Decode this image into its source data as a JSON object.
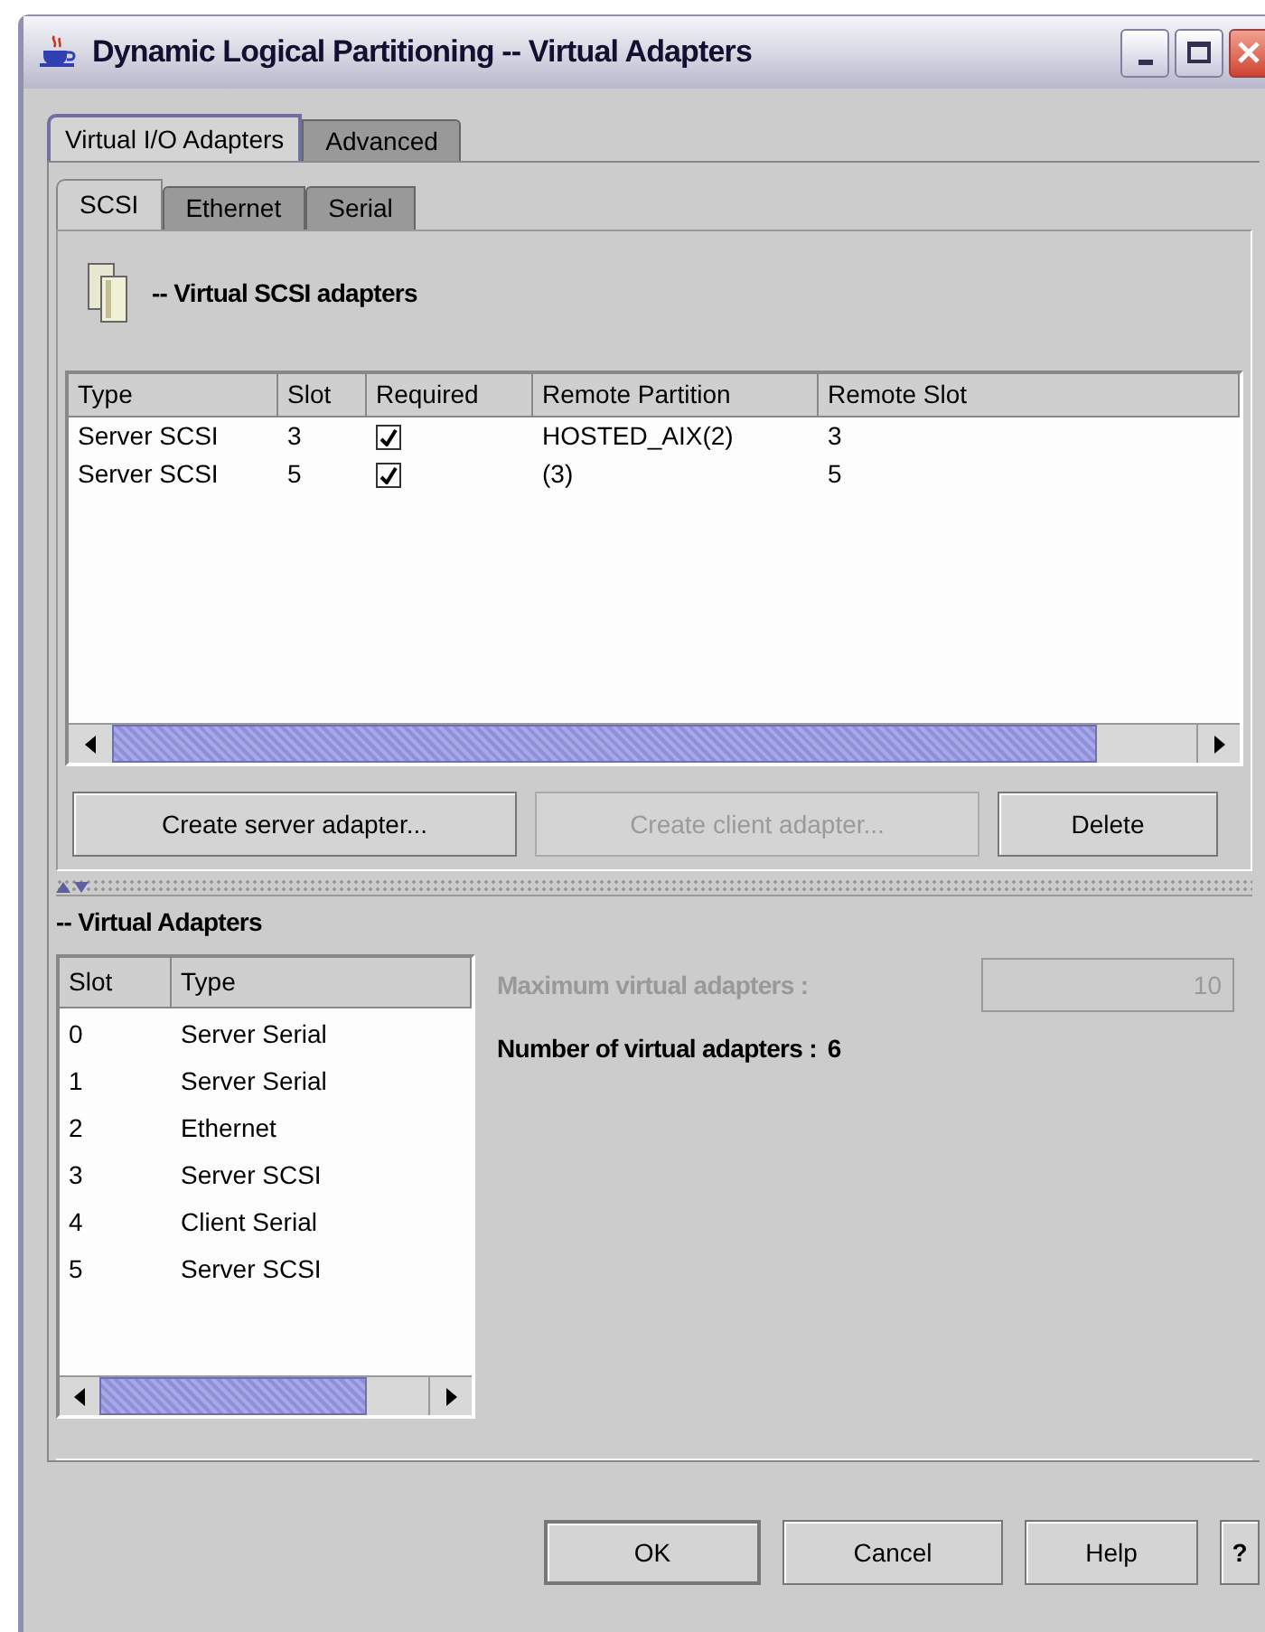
{
  "window": {
    "title": "Dynamic Logical Partitioning -- Virtual Adapters"
  },
  "outer_tabs": [
    {
      "label": "Virtual I/O Adapters",
      "selected": true
    },
    {
      "label": "Advanced",
      "selected": false
    }
  ],
  "inner_tabs": [
    {
      "label": "SCSI",
      "selected": true
    },
    {
      "label": "Ethernet",
      "selected": false
    },
    {
      "label": "Serial",
      "selected": false
    }
  ],
  "section_title": "-- Virtual SCSI adapters",
  "table": {
    "columns": [
      "Type",
      "Slot",
      "Required",
      "Remote Partition",
      "Remote Slot"
    ],
    "rows": [
      {
        "type": "Server SCSI",
        "slot": "3",
        "required": true,
        "remote_partition": "HOSTED_AIX(2)",
        "remote_slot": "3"
      },
      {
        "type": "Server SCSI",
        "slot": "5",
        "required": true,
        "remote_partition": "(3)",
        "remote_slot": "5"
      }
    ]
  },
  "buttons": [
    {
      "label": "Create server adapter...",
      "disabled": false
    },
    {
      "label": "Create client adapter...",
      "disabled": true
    },
    {
      "label": "Delete",
      "disabled": false
    }
  ],
  "adapters": {
    "title": "-- Virtual Adapters",
    "columns": [
      "Slot",
      "Type"
    ],
    "rows": [
      {
        "slot": "0",
        "type": "Server Serial"
      },
      {
        "slot": "1",
        "type": "Server Serial"
      },
      {
        "slot": "2",
        "type": "Ethernet"
      },
      {
        "slot": "3",
        "type": "Server SCSI"
      },
      {
        "slot": "4",
        "type": "Client Serial"
      },
      {
        "slot": "5",
        "type": "Server SCSI"
      }
    ]
  },
  "max_adapters": {
    "label": "Maximum virtual adapters :",
    "value": "10",
    "disabled": true
  },
  "count": {
    "label": "Number of virtual adapters :",
    "value": "6"
  },
  "dialog_buttons": [
    {
      "label": "OK"
    },
    {
      "label": "Cancel"
    },
    {
      "label": "Help"
    },
    {
      "label": "?"
    }
  ]
}
